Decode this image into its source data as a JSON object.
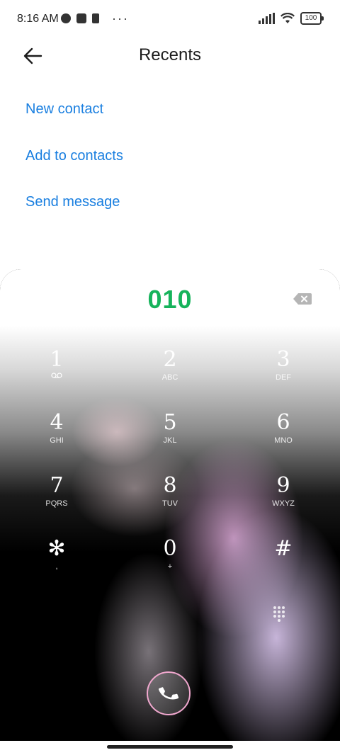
{
  "status_bar": {
    "time": "8:16 AM",
    "more": "···",
    "battery": "100",
    "icons": [
      "data-saver-icon",
      "notification-square-icon",
      "sim-icon",
      "signal-icon",
      "wifi-icon",
      "battery-icon"
    ]
  },
  "header": {
    "title": "Recents",
    "back_icon": "arrow-left-icon"
  },
  "actions": {
    "new_contact": "New contact",
    "add_to_contacts": "Add to contacts",
    "send_message": "Send message"
  },
  "dialer": {
    "entered_number": "010",
    "number_color": "#16b35b",
    "backspace_icon": "backspace-icon",
    "keys": [
      {
        "digit": "1",
        "letters": ""
      },
      {
        "digit": "2",
        "letters": "ABC"
      },
      {
        "digit": "3",
        "letters": "DEF"
      },
      {
        "digit": "4",
        "letters": "GHI"
      },
      {
        "digit": "5",
        "letters": "JKL"
      },
      {
        "digit": "6",
        "letters": "MNO"
      },
      {
        "digit": "7",
        "letters": "PQRS"
      },
      {
        "digit": "8",
        "letters": "TUV"
      },
      {
        "digit": "9",
        "letters": "WXYZ"
      },
      {
        "digit": "✻",
        "letters": ","
      },
      {
        "digit": "0",
        "letters": "+"
      },
      {
        "digit": "#",
        "letters": ""
      }
    ],
    "voicemail_icon": "voicemail-icon",
    "dialpad_toggle_icon": "dialpad-grid-icon",
    "call_icon": "phone-icon",
    "call_ring_color": "#f1a8cf"
  },
  "colors": {
    "accent": "#1a7fe0",
    "title": "#1c1c1c"
  }
}
